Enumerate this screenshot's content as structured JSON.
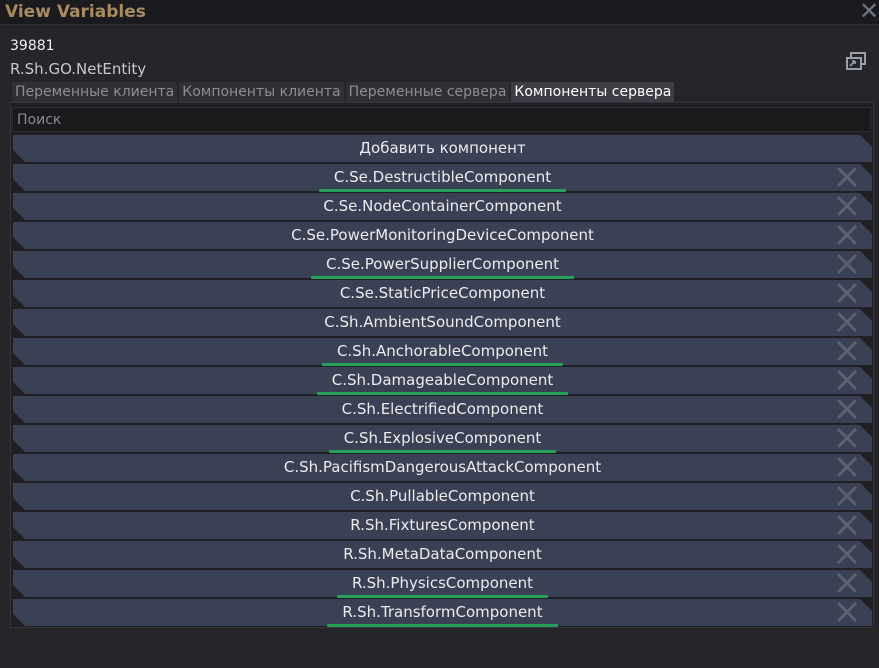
{
  "window": {
    "title": "View Variables",
    "close_glyph": "✕"
  },
  "entity": {
    "id": "39881",
    "type": "R.Sh.GO.NetEntity"
  },
  "tabs": [
    {
      "label": "Переменные клиента",
      "active": false
    },
    {
      "label": "Компоненты клиента",
      "active": false
    },
    {
      "label": "Переменные сервера",
      "active": false
    },
    {
      "label": "Компоненты сервера",
      "active": true
    }
  ],
  "search": {
    "placeholder": "Поиск",
    "value": ""
  },
  "add_button": {
    "label": "Добавить компонент"
  },
  "components": [
    {
      "label": "C.Se.DestructibleComponent",
      "highlighted": true
    },
    {
      "label": "C.Se.NodeContainerComponent",
      "highlighted": false
    },
    {
      "label": "C.Se.PowerMonitoringDeviceComponent",
      "highlighted": false
    },
    {
      "label": "C.Se.PowerSupplierComponent",
      "highlighted": true
    },
    {
      "label": "C.Se.StaticPriceComponent",
      "highlighted": false
    },
    {
      "label": "C.Sh.AmbientSoundComponent",
      "highlighted": false
    },
    {
      "label": "C.Sh.AnchorableComponent",
      "highlighted": true
    },
    {
      "label": "C.Sh.DamageableComponent",
      "highlighted": true
    },
    {
      "label": "C.Sh.ElectrifiedComponent",
      "highlighted": false
    },
    {
      "label": "C.Sh.ExplosiveComponent",
      "highlighted": true
    },
    {
      "label": "C.Sh.PacifismDangerousAttackComponent",
      "highlighted": false
    },
    {
      "label": "C.Sh.PullableComponent",
      "highlighted": false
    },
    {
      "label": "R.Sh.FixturesComponent",
      "highlighted": false
    },
    {
      "label": "R.Sh.MetaDataComponent",
      "highlighted": false
    },
    {
      "label": "R.Sh.PhysicsComponent",
      "highlighted": true
    },
    {
      "label": "R.Sh.TransformComponent",
      "highlighted": true
    }
  ],
  "colors": {
    "title": "#a88b5e",
    "row_bg": "#3b4154",
    "highlight_underline": "#27a05a",
    "remove_icon": "#5b6272"
  },
  "icons": {
    "close": "close-icon",
    "view_entity": "view-entity-icon",
    "remove": "remove-component-icon"
  }
}
